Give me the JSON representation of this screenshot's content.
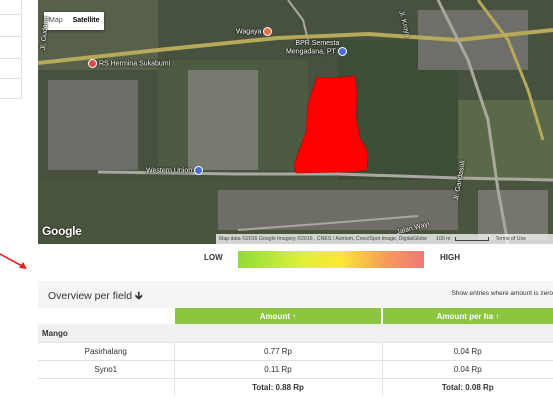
{
  "map": {
    "type_buttons": [
      "Map",
      "Satellite"
    ],
    "active_type": "Satellite",
    "places": {
      "wagaya": "Wagaya",
      "bpr": "BPR Semesta",
      "bpr2": "Mengadana, PT",
      "rs": "RS Hermina Sukabumi",
      "western": "Western Union",
      "gudang": "Jl. Gudang",
      "jalan": "Jalan Wayi",
      "gandasoli": "Jl. Gandasoli",
      "kroya": "Jl. Kroya"
    },
    "logo": "Google",
    "attribution": "Map data ©2016 Google Imagery ©2016 , CNES / Astrium, Cnes/Spot Image, DigitalGlobe",
    "scale_label": "100 m",
    "terms": "Terms of Use",
    "field_color": "#ff0000"
  },
  "legend": {
    "low": "LOW",
    "high": "HIGH"
  },
  "overview": {
    "title": "Overview per field",
    "sort_icon": "arrow-down-icon",
    "hint": "Show entries where amount is zero",
    "columns": [
      "",
      "Amount ↑",
      "Amount per ha ↑"
    ],
    "group": "Mango",
    "rows": [
      {
        "name": "Pasirhalang",
        "amount": "0.77 Rp",
        "per_ha": "0.04 Rp"
      },
      {
        "name": "Syno1",
        "amount": "0.11 Rp",
        "per_ha": "0.04 Rp"
      }
    ],
    "total_amount": "Total: 0.88 Rp",
    "total_per_ha": "Total: 0.08 Rp"
  }
}
